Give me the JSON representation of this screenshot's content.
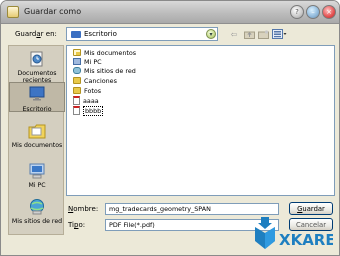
{
  "window": {
    "title": "Guardar como"
  },
  "save_in": {
    "label_pre": "Guard",
    "label_accel": "a",
    "label_post": "r en:",
    "value": "Escritorio"
  },
  "toolbar": {
    "back_icon": "back-arrow-icon",
    "up_icon": "up-folder-icon",
    "new_folder_icon": "new-folder-icon",
    "views_icon": "views-menu-icon"
  },
  "places": [
    {
      "label": "Documentos recientes",
      "icon": "recent-documents-icon"
    },
    {
      "label": "Escritorio",
      "icon": "desktop-icon"
    },
    {
      "label": "Mis documentos",
      "icon": "my-documents-icon"
    },
    {
      "label": "Mi PC",
      "icon": "my-computer-icon"
    },
    {
      "label": "Mis sitios de red",
      "icon": "network-places-icon"
    }
  ],
  "files": [
    {
      "name": "Mis documentos",
      "icon": "docs"
    },
    {
      "name": "Mi PC",
      "icon": "pc"
    },
    {
      "name": "Mis sitios de red",
      "icon": "net"
    },
    {
      "name": "Canciones",
      "icon": "folder"
    },
    {
      "name": "Fotos",
      "icon": "folder"
    },
    {
      "name": "aaaa",
      "icon": "file"
    },
    {
      "name": "bbbb",
      "icon": "file",
      "selected": true
    }
  ],
  "filename": {
    "label_accel": "N",
    "label_rest": "ombre:",
    "value": "mg_tradecards_geometry_SPAN"
  },
  "filetype": {
    "label_pre": "Ti",
    "label_accel": "p",
    "label_post": "o:",
    "value": "PDF File(*.pdf)"
  },
  "buttons": {
    "save_accel": "G",
    "save_rest": "uardar",
    "cancel": "Cancelar"
  },
  "watermark": {
    "text": "XKARE"
  },
  "colors": {
    "dialog_bg": "#ece9d8",
    "logo_blue": "#1e7fc0"
  }
}
